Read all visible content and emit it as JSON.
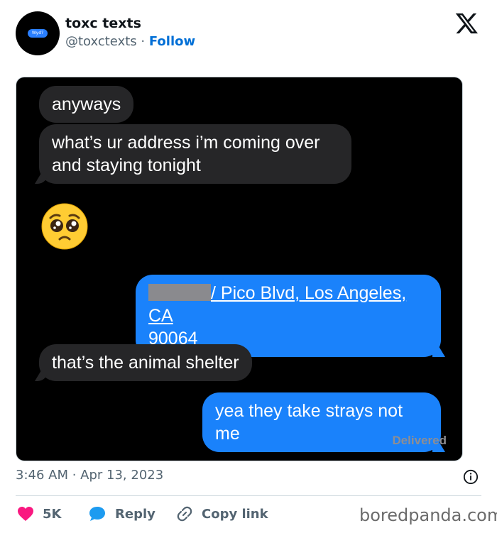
{
  "header": {
    "avatar_text": "Wyd?",
    "display_name": "toxc texts",
    "handle": "@toxctexts",
    "separator": "·",
    "follow_label": "Follow"
  },
  "messages": [
    {
      "side": "received",
      "text": "anyways"
    },
    {
      "side": "received",
      "text": "what’s ur address i’m coming over and staying tonight"
    },
    {
      "side": "received",
      "emoji": "pleading-face"
    },
    {
      "side": "sent",
      "text_line1": "/ Pico Blvd, Los Angeles, CA",
      "text_line2": "90064"
    },
    {
      "side": "received",
      "text": "that’s the animal shelter"
    },
    {
      "side": "sent",
      "text": "yea they take strays not me"
    }
  ],
  "status": "Delivered",
  "footer": {
    "timestamp": "3:46 AM · Apr 13, 2023",
    "likes": "5K",
    "reply_label": "Reply",
    "copy_link_label": "Copy link"
  },
  "watermark": "boredpanda.com",
  "colors": {
    "accent": "#006fd6",
    "sent_bubble": "#1a82fb",
    "received_bubble": "#262628",
    "like": "#f91880"
  }
}
